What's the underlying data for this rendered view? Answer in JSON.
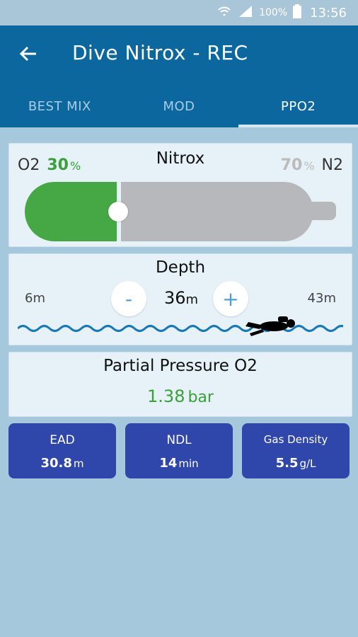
{
  "status_bar": {
    "battery_percent": "100%",
    "time": "13:56"
  },
  "app_bar": {
    "title": "Dive Nitrox - REC"
  },
  "tabs": [
    {
      "label": "BEST MIX",
      "active": false
    },
    {
      "label": "MOD",
      "active": false
    },
    {
      "label": "PPO2",
      "active": true
    }
  ],
  "nitrox": {
    "title": "Nitrox",
    "o2_label": "O2",
    "o2_value": "30",
    "o2_unit": "%",
    "n2_label": "N2",
    "n2_value": "70",
    "n2_unit": "%",
    "o2_fraction": 0.3
  },
  "depth": {
    "title": "Depth",
    "min": "6m",
    "max": "43m",
    "value": "36",
    "unit": "m",
    "minus_label": "-",
    "plus_label": "+"
  },
  "partial_pressure": {
    "title": "Partial Pressure O2",
    "value": "1.38",
    "unit": "bar"
  },
  "stats": {
    "ead": {
      "label": "EAD",
      "value": "30.8",
      "unit": "m"
    },
    "ndl": {
      "label": "NDL",
      "value": "14",
      "unit": "min"
    },
    "gas_density": {
      "label": "Gas Density",
      "value": "5.5",
      "unit": "g/L"
    }
  },
  "colors": {
    "app_bar": "#0b679e",
    "background": "#a6c8dc",
    "o2_green": "#45a845",
    "n2_gray": "#b7b8bb",
    "stat_blue": "#2f46aa"
  }
}
